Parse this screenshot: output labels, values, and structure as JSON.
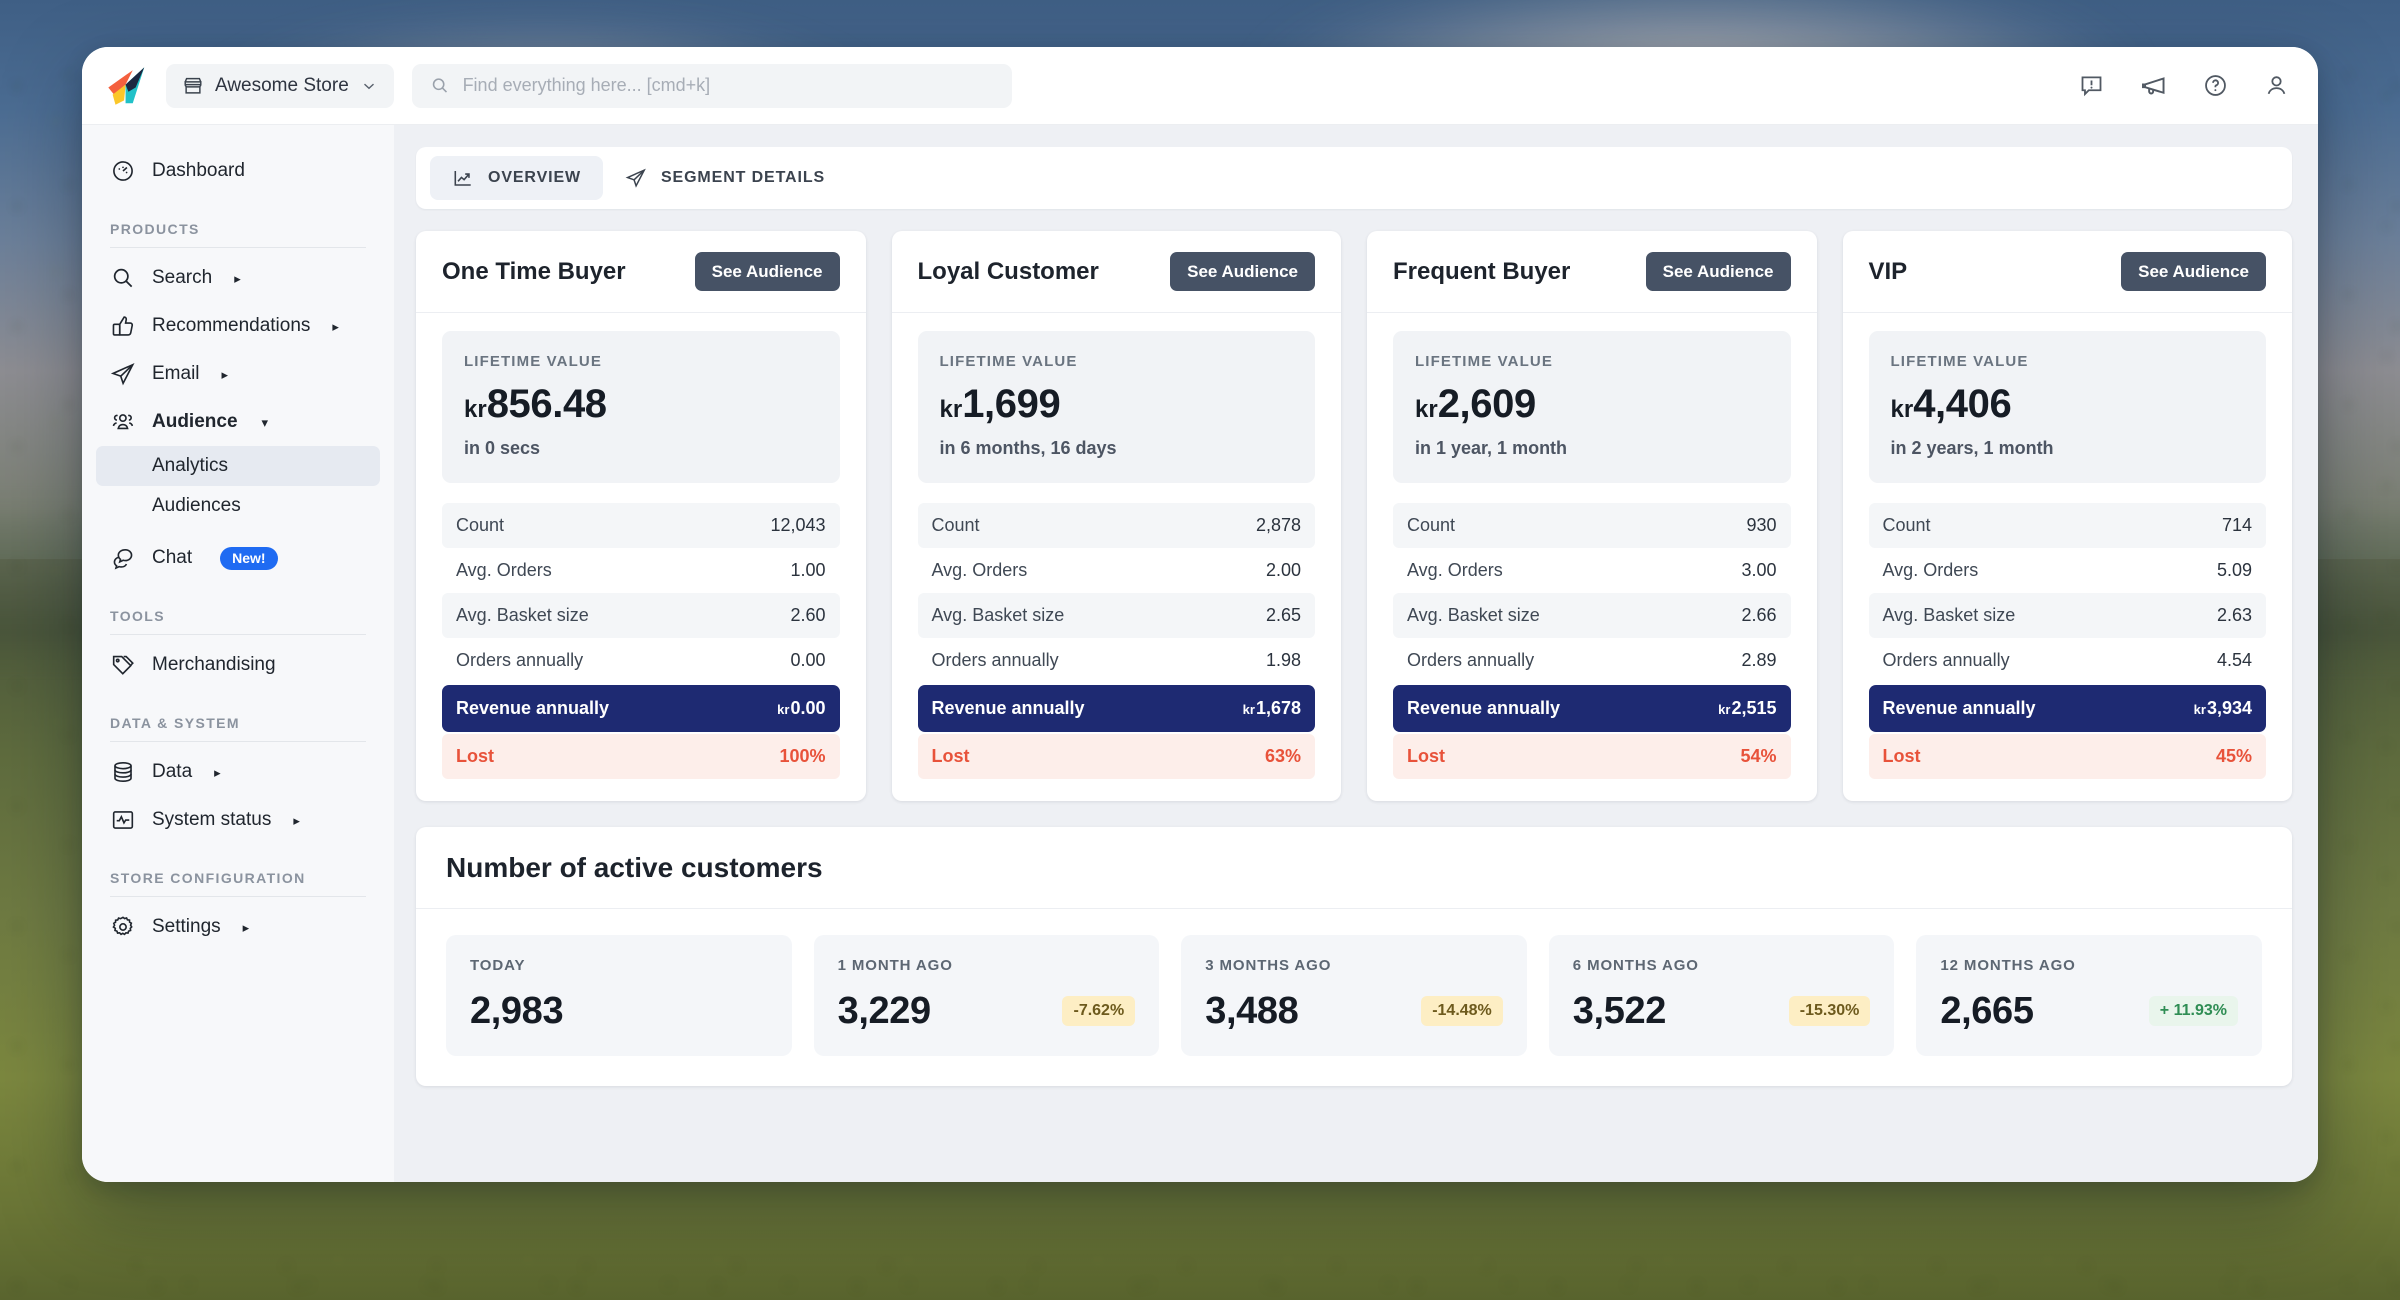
{
  "topbar": {
    "logo_icon": "rocket-logo-icon",
    "store_switcher": {
      "icon": "store-icon",
      "label": "Awesome Store",
      "caret": "chevron-down-icon"
    },
    "search": {
      "icon": "search-icon",
      "value": "",
      "placeholder": "Find everything here... [cmd+k]"
    },
    "actions": [
      {
        "icon": "feedback-icon",
        "name": "feedback-button"
      },
      {
        "icon": "announcement-icon",
        "name": "announcements-button"
      },
      {
        "icon": "help-icon",
        "name": "help-button"
      },
      {
        "icon": "user-icon",
        "name": "account-button"
      }
    ]
  },
  "sidebar": {
    "dashboard": {
      "icon": "dashboard-icon",
      "label": "Dashboard"
    },
    "sections": [
      {
        "title": "PRODUCTS",
        "items": [
          {
            "icon": "search-icon",
            "label": "Search",
            "caret": "▸"
          },
          {
            "icon": "thumbs-up-icon",
            "label": "Recommendations",
            "caret": "▸"
          },
          {
            "icon": "paper-plane-icon",
            "label": "Email",
            "caret": "▸"
          },
          {
            "icon": "people-icon",
            "label": "Audience",
            "caret": "▾",
            "active": true,
            "children": [
              {
                "label": "Analytics",
                "selected": true
              },
              {
                "label": "Audiences",
                "selected": false
              }
            ]
          },
          {
            "icon": "chat-icon",
            "label": "Chat",
            "badge": "New!"
          }
        ]
      },
      {
        "title": "TOOLS",
        "items": [
          {
            "icon": "tag-icon",
            "label": "Merchandising"
          }
        ]
      },
      {
        "title": "DATA & SYSTEM",
        "items": [
          {
            "icon": "database-icon",
            "label": "Data",
            "caret": "▸"
          },
          {
            "icon": "activity-icon",
            "label": "System status",
            "caret": "▸"
          }
        ]
      },
      {
        "title": "STORE CONFIGURATION",
        "items": [
          {
            "icon": "gear-icon",
            "label": "Settings",
            "caret": "▸"
          }
        ]
      }
    ]
  },
  "tabs": [
    {
      "icon": "chart-line-icon",
      "label": "OVERVIEW",
      "active": true
    },
    {
      "icon": "paper-plane-icon",
      "label": "SEGMENT DETAILS",
      "active": false
    }
  ],
  "segments": {
    "button_label": "See Audience",
    "ltv_label": "LIFETIME VALUE",
    "metric_labels": [
      "Count",
      "Avg. Orders",
      "Avg. Basket size",
      "Orders annually",
      "Revenue annually",
      "Lost"
    ],
    "cards": [
      {
        "title": "One Time Buyer",
        "ltv_currency": "kr",
        "ltv_value": "856.48",
        "ltv_sub": "in 0 secs",
        "count": "12,043",
        "avg_orders": "1.00",
        "avg_basket": "2.60",
        "orders_annually": "0.00",
        "revenue_currency": "kr",
        "revenue_annually": "0.00",
        "lost": "100%"
      },
      {
        "title": "Loyal Customer",
        "ltv_currency": "kr",
        "ltv_value": "1,699",
        "ltv_sub": "in 6 months, 16 days",
        "count": "2,878",
        "avg_orders": "2.00",
        "avg_basket": "2.65",
        "orders_annually": "1.98",
        "revenue_currency": "kr",
        "revenue_annually": "1,678",
        "lost": "63%"
      },
      {
        "title": "Frequent Buyer",
        "ltv_currency": "kr",
        "ltv_value": "2,609",
        "ltv_sub": "in 1 year, 1 month",
        "count": "930",
        "avg_orders": "3.00",
        "avg_basket": "2.66",
        "orders_annually": "2.89",
        "revenue_currency": "kr",
        "revenue_annually": "2,515",
        "lost": "54%"
      },
      {
        "title": "VIP",
        "ltv_currency": "kr",
        "ltv_value": "4,406",
        "ltv_sub": "in 2 years, 1 month",
        "count": "714",
        "avg_orders": "5.09",
        "avg_basket": "2.63",
        "orders_annually": "4.54",
        "revenue_currency": "kr",
        "revenue_annually": "3,934",
        "lost": "45%"
      }
    ]
  },
  "active_customers": {
    "title": "Number of active customers",
    "items": [
      {
        "label": "TODAY",
        "value": "2,983",
        "delta": "",
        "direction": "none"
      },
      {
        "label": "1 MONTH AGO",
        "value": "3,229",
        "delta": "-7.62%",
        "direction": "down"
      },
      {
        "label": "3 MONTHS AGO",
        "value": "3,488",
        "delta": "-14.48%",
        "direction": "down"
      },
      {
        "label": "6 MONTHS AGO",
        "value": "3,522",
        "delta": "-15.30%",
        "direction": "down"
      },
      {
        "label": "12 MONTHS AGO",
        "value": "2,665",
        "delta": "+ 11.93%",
        "direction": "up"
      }
    ]
  },
  "colors": {
    "accent_navy": "#1e2a72",
    "button_slate": "#465265",
    "lost_red": "#e8523a",
    "badge_blue": "#1f6bf2",
    "delta_down_bg": "#fdeec4",
    "delta_up_fg": "#2f8d54"
  }
}
